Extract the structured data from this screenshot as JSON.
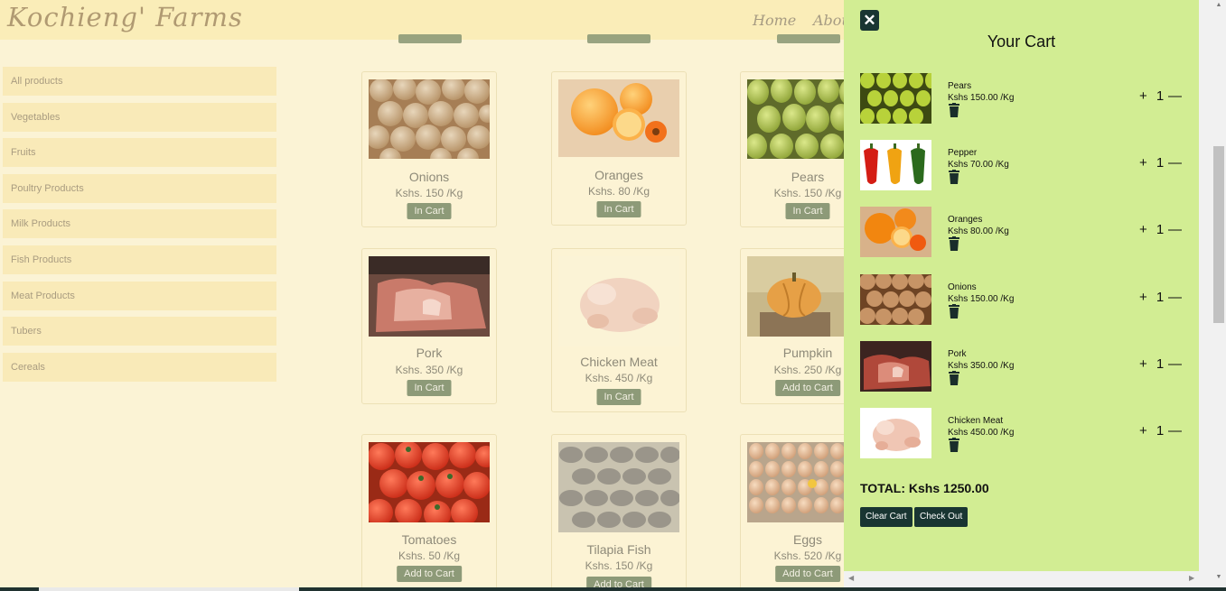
{
  "header": {
    "logo": "Kochieng' Farms",
    "nav": [
      "Home",
      "About"
    ]
  },
  "sidebar": {
    "items": [
      "All products",
      "Vegetables",
      "Fruits",
      "Poultry Products",
      "Milk Products",
      "Fish Products",
      "Meat Products",
      "Tubers",
      "Cereals"
    ]
  },
  "products": [
    {
      "name": "Onions",
      "price": "Kshs. 150 /Kg",
      "button": "In Cart"
    },
    {
      "name": "Oranges",
      "price": "Kshs. 80 /Kg",
      "button": "In Cart"
    },
    {
      "name": "Pears",
      "price": "Kshs. 150 /Kg",
      "button": "In Cart"
    },
    {
      "name": "Pork",
      "price": "Kshs. 350 /Kg",
      "button": "In Cart"
    },
    {
      "name": "Chicken Meat",
      "price": "Kshs. 450 /Kg",
      "button": "In Cart"
    },
    {
      "name": "Pumpkin",
      "price": "Kshs. 250 /Kg",
      "button": "Add to Cart"
    },
    {
      "name": "Tomatoes",
      "price": "Kshs. 50 /Kg",
      "button": "Add to Cart"
    },
    {
      "name": "Tilapia Fish",
      "price": "Kshs. 150 /Kg",
      "button": "Add to Cart"
    },
    {
      "name": "Eggs",
      "price": "Kshs. 520 /Kg",
      "button": "Add to Cart"
    }
  ],
  "cart": {
    "close_icon": "close-icon",
    "title": "Your Cart",
    "items": [
      {
        "name": "Pears",
        "price": "Kshs 150.00 /Kg",
        "qty": "1"
      },
      {
        "name": "Pepper",
        "price": "Kshs 70.00 /Kg",
        "qty": "1"
      },
      {
        "name": "Oranges",
        "price": "Kshs 80.00 /Kg",
        "qty": "1"
      },
      {
        "name": "Onions",
        "price": "Kshs 150.00 /Kg",
        "qty": "1"
      },
      {
        "name": "Pork",
        "price": "Kshs 350.00 /Kg",
        "qty": "1"
      },
      {
        "name": "Chicken Meat",
        "price": "Kshs 450.00 /Kg",
        "qty": "1"
      }
    ],
    "total": "TOTAL: Kshs 1250.00",
    "clear_label": "Clear Cart",
    "checkout_label": "Check Out"
  },
  "symbols": {
    "plus": "+",
    "minus": "—",
    "close": "✕"
  }
}
